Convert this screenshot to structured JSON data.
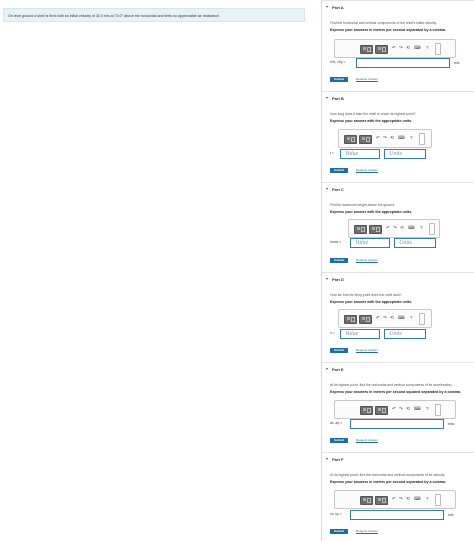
{
  "problem": {
    "text": "On level ground a shell is fired with an initial velocity of 30.0 m/s at 70.0° above the horizontal and feels no appreciable air resistance."
  },
  "toolbar": {
    "undo_glyph": "↶",
    "redo_glyph": "↷",
    "reset_glyph": "⟲",
    "keyboard_glyph": "⌨",
    "help_glyph": "?"
  },
  "common": {
    "submit_label": "Submit",
    "request_label": "Request Answer",
    "value_placeholder": "Value",
    "units_placeholder": "Units"
  },
  "parts": [
    {
      "title": "Part A",
      "question": "Find the horizontal and vertical components of the shell's initial velocity.",
      "instruction": "Express your answers in meters per second separated by a comma.",
      "label": "v0x, v0y =",
      "unit": "m/s",
      "type": "single"
    },
    {
      "title": "Part B",
      "question": "How long does it take the shell to reach its highest point?",
      "instruction": "Express your answer with the appropriate units.",
      "label": "t =",
      "type": "value-units"
    },
    {
      "title": "Part C",
      "question": "Find its maximum height above the ground.",
      "instruction": "Express your answer with the appropriate units.",
      "label": "hmax =",
      "type": "value-units"
    },
    {
      "title": "Part D",
      "question": "How far from its firing point does the shell land?",
      "instruction": "Express your answer with the appropriate units.",
      "label": "x =",
      "type": "value-units"
    },
    {
      "title": "Part E",
      "question": "At its highest point, find the horizontal and vertical components of its acceleration.",
      "instruction": "Express your answers in meters per second squared separated by a comma.",
      "label": "ax, ay =",
      "unit": "m/s²",
      "type": "single"
    },
    {
      "title": "Part F",
      "question": "At its highest point, find the horizontal and vertical components of its velocity.",
      "instruction": "Express your answers in meters per second separated by a comma.",
      "label": "vx, vy =",
      "unit": "m/s",
      "type": "single"
    }
  ]
}
